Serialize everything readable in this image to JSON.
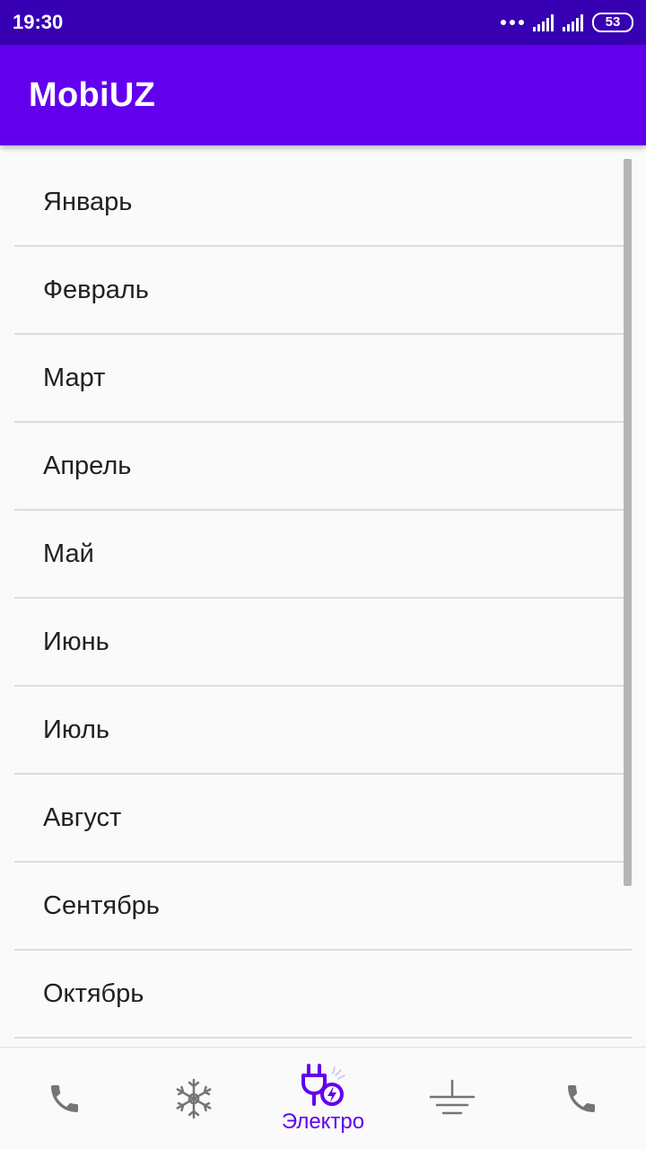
{
  "status_bar": {
    "time": "19:30",
    "battery": "53"
  },
  "app_bar": {
    "title": "MobiUZ"
  },
  "months": [
    {
      "label": "Январь"
    },
    {
      "label": "Февраль"
    },
    {
      "label": "Март"
    },
    {
      "label": "Апрель"
    },
    {
      "label": "Май"
    },
    {
      "label": "Июнь"
    },
    {
      "label": "Июль"
    },
    {
      "label": "Август"
    },
    {
      "label": "Сентябрь"
    },
    {
      "label": "Октябрь"
    }
  ],
  "bottom_nav": {
    "items": [
      {
        "icon": "phone-icon",
        "label": ""
      },
      {
        "icon": "snowflake-icon",
        "label": ""
      },
      {
        "icon": "plug-icon",
        "label": "Электро",
        "active": true
      },
      {
        "icon": "ground-icon",
        "label": ""
      },
      {
        "icon": "phone-icon",
        "label": ""
      }
    ]
  },
  "colors": {
    "status_bar": "#3700b3",
    "primary": "#6200ee",
    "inactive_icon": "#757575",
    "text": "#212121"
  }
}
